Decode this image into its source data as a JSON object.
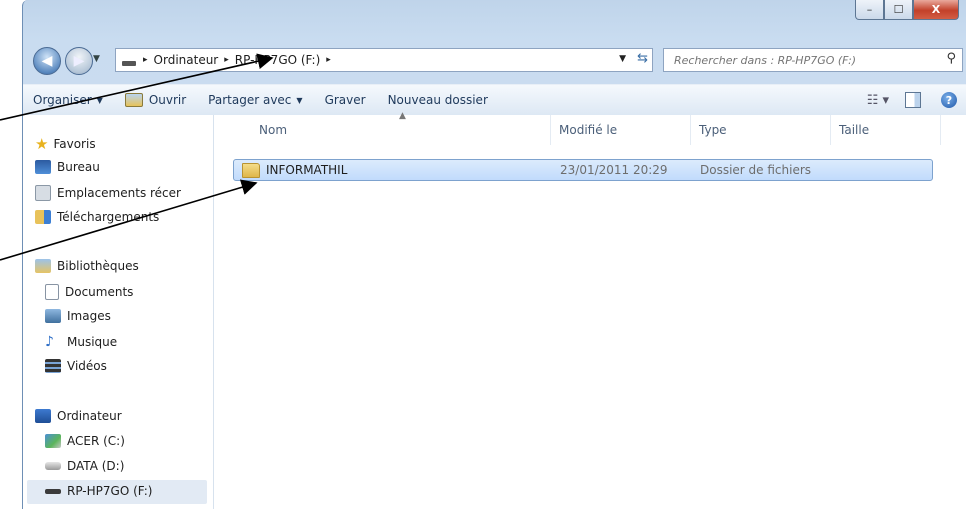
{
  "window": {
    "min_label": "–",
    "max_label": "☐",
    "close_label": "X"
  },
  "address": {
    "crumbs": [
      "Ordinateur",
      "RP-HP7GO (F:)"
    ],
    "separator": "▸"
  },
  "search": {
    "placeholder": "Rechercher dans : RP-HP7GO (F:)"
  },
  "toolbar": {
    "organiser": "Organiser",
    "ouvrir": "Ouvrir",
    "partager": "Partager avec",
    "graver": "Graver",
    "nouveau_dossier": "Nouveau dossier"
  },
  "sidebar": {
    "favoris": "Favoris",
    "bureau": "Bureau",
    "emplacements": "Emplacements récer",
    "telechargements": "Téléchargements",
    "bibliotheques": "Bibliothèques",
    "documents": "Documents",
    "images": "Images",
    "musique": "Musique",
    "videos": "Vidéos",
    "ordinateur": "Ordinateur",
    "acer": "ACER (C:)",
    "data": "DATA (D:)",
    "rp": "RP-HP7GO (F:)"
  },
  "columns": {
    "nom": "Nom",
    "modifie": "Modifié le",
    "type": "Type",
    "taille": "Taille"
  },
  "files": [
    {
      "name": "INFORMATHIL",
      "modified": "23/01/2011 20:29",
      "type": "Dossier de fichiers",
      "size": ""
    }
  ]
}
